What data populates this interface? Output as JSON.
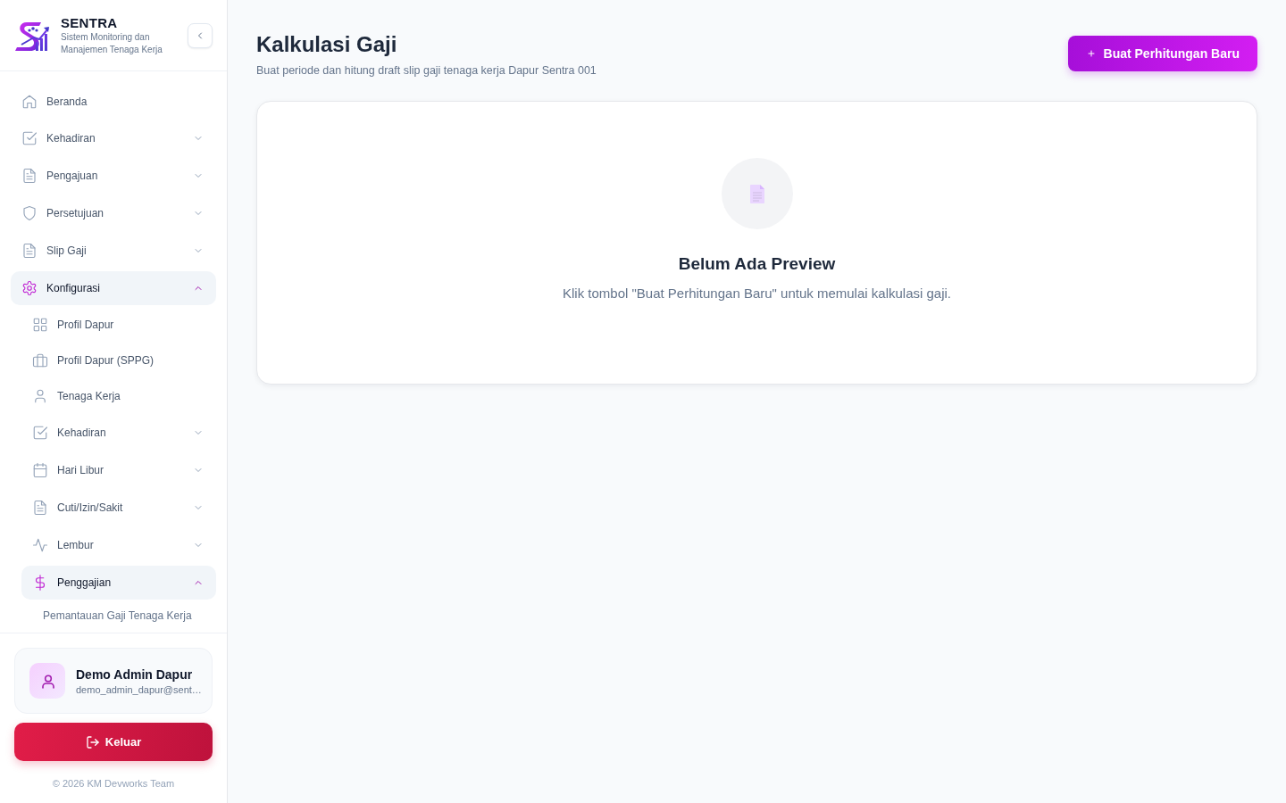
{
  "sidebar": {
    "brand": {
      "title": "SENTRA",
      "subtitle": "Sistem Monitoring dan Manajemen Tenaga Kerja"
    },
    "items": [
      {
        "kind": "link",
        "label": "Beranda"
      },
      {
        "kind": "group",
        "label": "Kehadiran",
        "expanded": false
      },
      {
        "kind": "group",
        "label": "Pengajuan",
        "expanded": false
      },
      {
        "kind": "group",
        "label": "Persetujuan",
        "expanded": false
      },
      {
        "kind": "group",
        "label": "Slip Gaji",
        "expanded": false
      },
      {
        "kind": "group",
        "label": "Konfigurasi",
        "expanded": true,
        "children": [
          {
            "kind": "link",
            "label": "Profil Dapur"
          },
          {
            "kind": "link",
            "label": "Profil Dapur (SPPG)"
          },
          {
            "kind": "link",
            "label": "Tenaga Kerja"
          },
          {
            "kind": "group",
            "label": "Kehadiran",
            "expanded": false
          },
          {
            "kind": "group",
            "label": "Hari Libur",
            "expanded": false
          },
          {
            "kind": "group",
            "label": "Cuti/Izin/Sakit",
            "expanded": false
          },
          {
            "kind": "group",
            "label": "Lembur",
            "expanded": false
          },
          {
            "kind": "group",
            "label": "Penggajian",
            "expanded": true,
            "children": [
              {
                "kind": "plain",
                "label": "Pemantauan Gaji Tenaga Kerja"
              }
            ]
          }
        ]
      }
    ],
    "user": {
      "name": "Demo Admin Dapur",
      "email": "demo_admin_dapur@sent…"
    },
    "logout_button": {
      "label": "Keluar"
    },
    "footer": "© 2026 KM Devworks Team"
  },
  "header": {
    "title": "Kalkulasi Gaji",
    "subtitle": "Buat periode dan hitung draft slip gaji tenaga kerja Dapur Sentra 001",
    "action_button": {
      "label": "Buat Perhitungan Baru"
    }
  },
  "empty_state": {
    "title": "Belum Ada Preview",
    "message": "Klik tombol \"Buat Perhitungan Baru\" untuk memulai kalkulasi gaji."
  }
}
